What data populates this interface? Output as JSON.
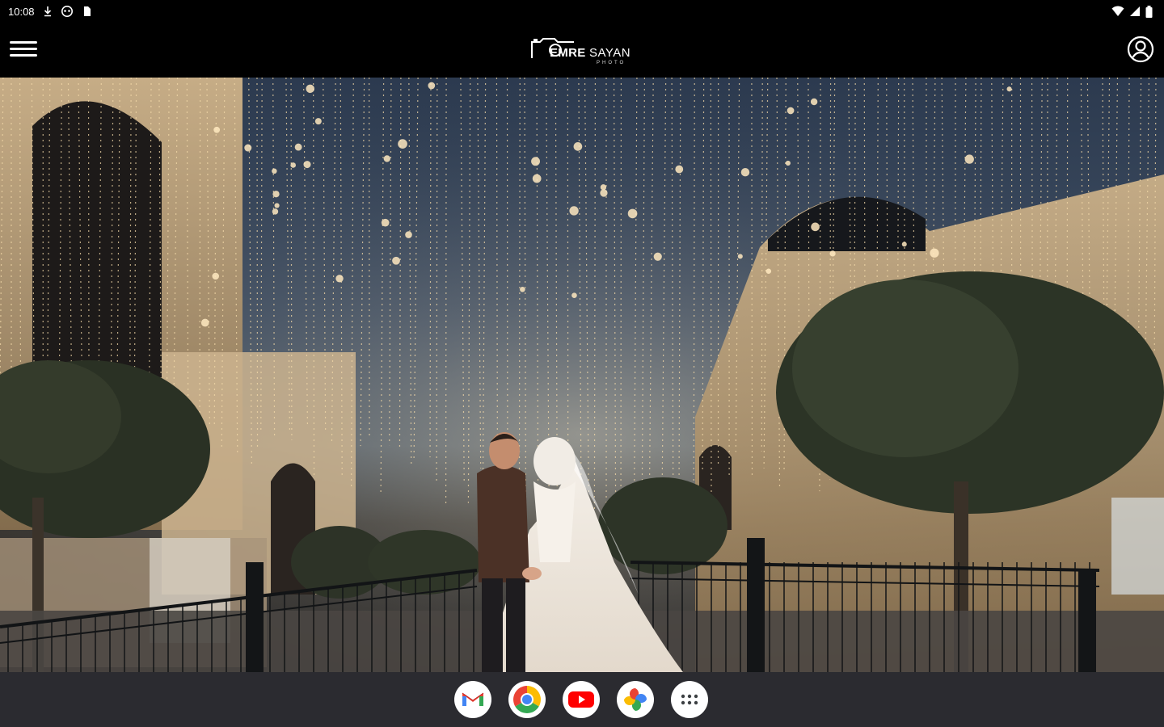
{
  "status_bar": {
    "time": "10:08",
    "left_icons": [
      "download-icon",
      "gamepad-icon",
      "sim-card-icon"
    ],
    "right_icons": [
      "wifi-icon",
      "signal-icon",
      "battery-icon"
    ]
  },
  "app_bar": {
    "menu_icon": "hamburger-menu-icon",
    "logo_text_bold": "EMRE",
    "logo_text_light": "SAYAN",
    "logo_sub": "PHOTO",
    "profile_icon": "account-circle-icon"
  },
  "hero": {
    "content": "photo-wedding-couple-under-string-lights"
  },
  "dock": {
    "apps": [
      {
        "name": "gmail-icon"
      },
      {
        "name": "chrome-icon"
      },
      {
        "name": "youtube-icon"
      },
      {
        "name": "photos-icon"
      },
      {
        "name": "app-drawer-icon"
      }
    ]
  },
  "colors": {
    "bar_background": "#000000",
    "dock_background": "#2b2b30",
    "accent_light": "#f3d9a8"
  }
}
